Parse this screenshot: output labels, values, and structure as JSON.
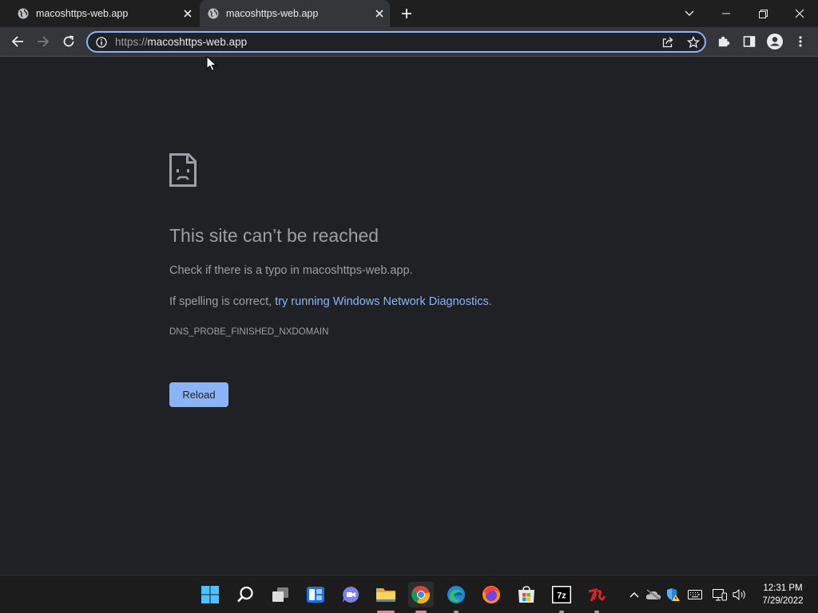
{
  "tabs": [
    {
      "title": "macoshttps-web.app",
      "active": false
    },
    {
      "title": "macoshttps-web.app",
      "active": true
    }
  ],
  "omnibox": {
    "scheme": "https://",
    "host": "macoshttps-web.app"
  },
  "error": {
    "heading": "This site can’t be reached",
    "line1": "Check if there is a typo in macoshttps-web.app.",
    "line2_prefix": "If spelling is correct, ",
    "line2_link": "try running Windows Network Diagnostics",
    "line2_suffix": ".",
    "code": "DNS_PROBE_FINISHED_NXDOMAIN",
    "reload_label": "Reload"
  },
  "taskbar": {
    "apps": [
      "windows-start",
      "search",
      "task-view",
      "widgets",
      "teams-chat",
      "file-explorer",
      "chrome",
      "edge",
      "firefox",
      "microsoft-store",
      "7-zip",
      "unknown-red-app"
    ],
    "clock": {
      "time": "12:31 PM",
      "date": "7/29/2022"
    }
  },
  "colors": {
    "accent": "#8ab4f8",
    "background": "#202124",
    "toolbar": "#35363a",
    "text_muted": "#9aa0a6"
  }
}
